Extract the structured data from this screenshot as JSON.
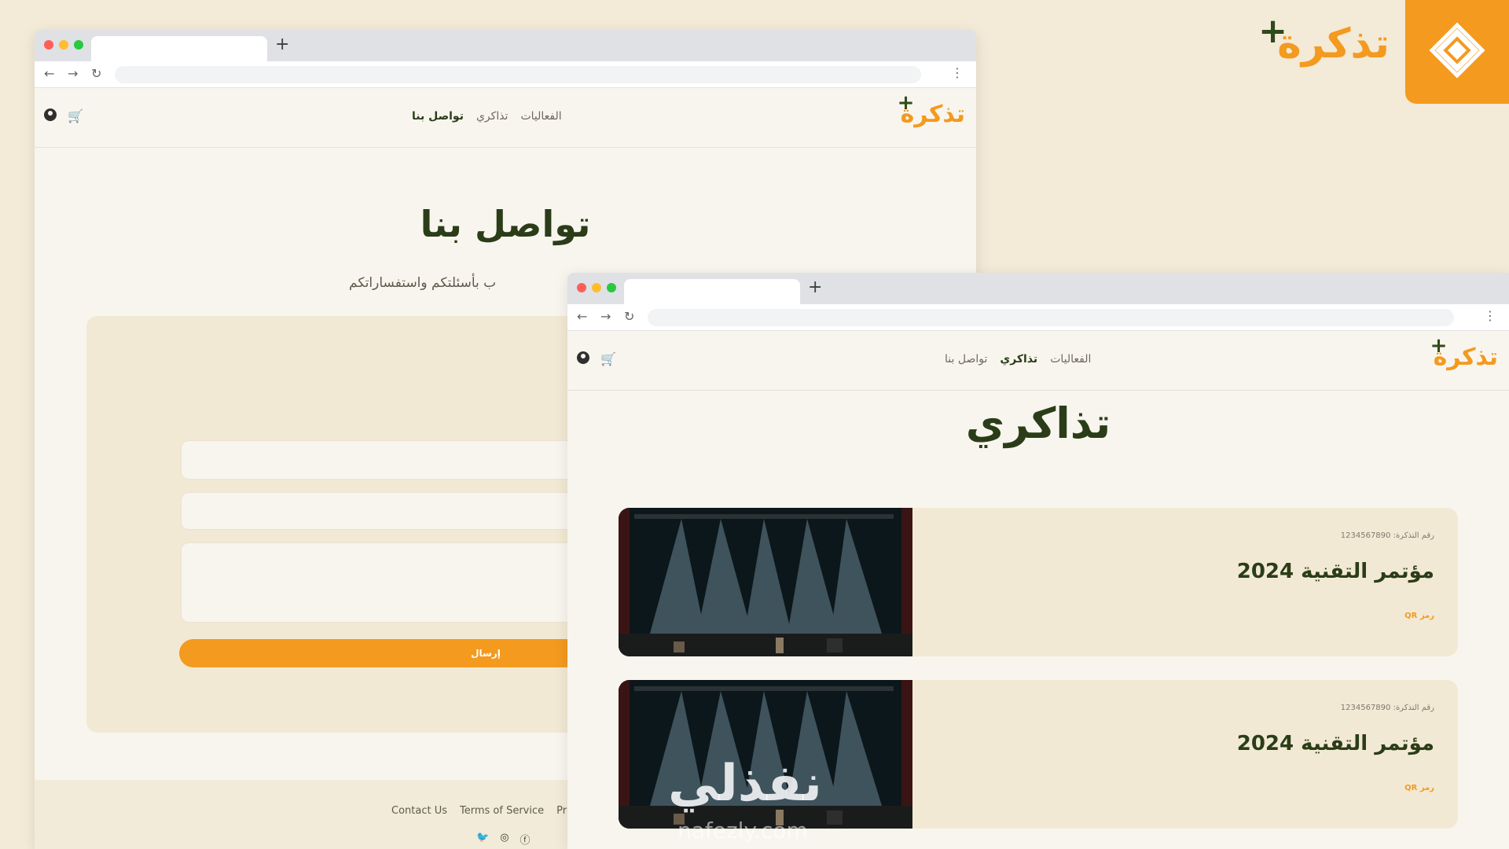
{
  "brand": {
    "name": "تذكرة",
    "plus": "+"
  },
  "contact_window": {
    "nav": {
      "events": "الفعاليات",
      "tickets": "تذاكري",
      "contact": "تواصل بنا"
    },
    "title": "تواصل بنا",
    "subtitle": "ب بأسئلتكم واستفساراتكم",
    "send_label": "إرسال",
    "footer_links": [
      "Contact Us",
      "Terms of Service",
      "Pri"
    ]
  },
  "tickets_window": {
    "nav": {
      "events": "الفعاليات",
      "tickets": "تذاكري",
      "contact": "تواصل بنا"
    },
    "title": "تذاكري",
    "tickets": [
      {
        "number_label": "رقم التذكرة: 1234567890",
        "name": "مؤتمر التقنية 2024",
        "qr_label": "رمز QR"
      },
      {
        "number_label": "رقم التذكرة: 1234567890",
        "name": "مؤتمر التقنية 2024",
        "qr_label": "رمز QR"
      }
    ]
  },
  "watermark": {
    "text": "نفذلي",
    "sub": "nafezly.com"
  },
  "colors": {
    "accent": "#f39a1f",
    "dark_green": "#2a3d18",
    "background": "#f3ead7",
    "card": "#f2e9d4"
  },
  "icons": [
    "back-icon",
    "forward-icon",
    "reload-icon",
    "user-icon",
    "cart-icon",
    "twitter-icon",
    "instagram-icon",
    "facebook-icon"
  ]
}
